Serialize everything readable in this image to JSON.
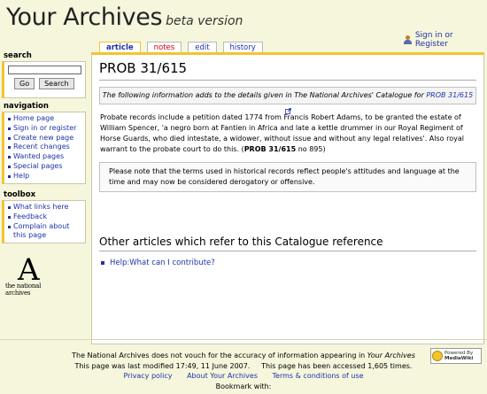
{
  "header": {
    "site_title": "Your Archives",
    "beta": "beta version",
    "login_link": "Sign in or Register"
  },
  "tabs": [
    {
      "label": "article"
    },
    {
      "label": "notes"
    },
    {
      "label": "edit"
    },
    {
      "label": "history"
    }
  ],
  "sidebar": {
    "search": {
      "heading": "search",
      "go_label": "Go",
      "search_label": "Search"
    },
    "navigation": {
      "heading": "navigation",
      "items": [
        "Home page",
        "Sign in or register",
        "Create new page",
        "Recent changes",
        "Wanted pages",
        "Special pages",
        "Help"
      ]
    },
    "toolbox": {
      "heading": "toolbox",
      "items": [
        "What links here",
        "Feedback",
        "Complain about this page"
      ]
    },
    "logo": {
      "letter": "A",
      "text": "the national archives"
    }
  },
  "article": {
    "title": "PROB 31/615",
    "info_prefix": "The following information adds to the details given in The National Archives' Catalogue for ",
    "info_link": "PROB 31/615",
    "body": "Probate records include a petition dated 1774 from Francis Robert Adams, to be granted the estate of William Spencer, 'a negro born at Fantien in Africa and late a kettle drummer in our Royal Regiment of Horse Guards, who died intestate, a widower, without issue and without any legal relatives'. Also royal warrant to the probate court to do this. (",
    "body_ref": "PROB 31/615",
    "body_ref_tail": " no 895)",
    "note": "Please note that the terms used in historical records reflect people's attitudes and language at the time and may now be considered derogatory or offensive.",
    "section_heading": "Other articles which refer to this Catalogue reference",
    "related_link": "Help:What can I contribute?"
  },
  "footer": {
    "disclaimer_prefix": "The National Archives does not vouch for the accuracy of information appearing in ",
    "disclaimer_site": "Your Archives",
    "modified": "This page was last modified 17:49, 11 June 2007.",
    "accessed": "This page has been accessed 1,605 times.",
    "links": [
      "Privacy policy",
      "About Your Archives",
      "Terms & conditions of use"
    ],
    "bookmark": "Bookmark with:",
    "badge_line1": "Powered By",
    "badge_line2": "MediaWiki"
  }
}
